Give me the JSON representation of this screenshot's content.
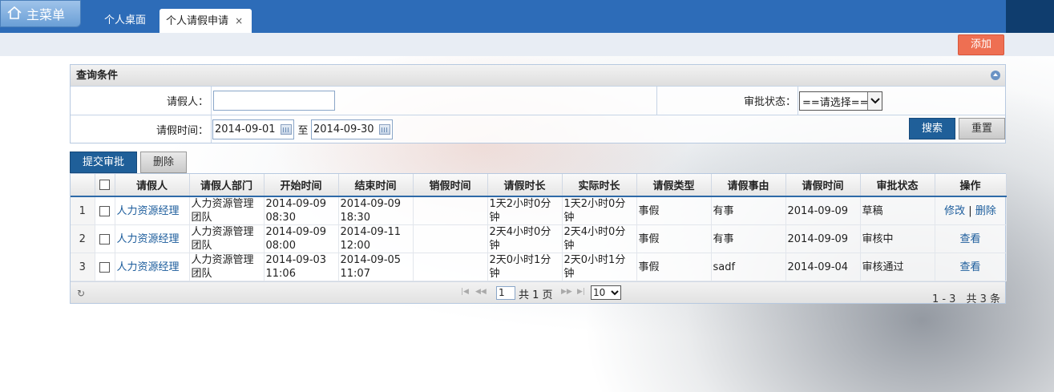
{
  "header": {
    "main_menu": "主菜单",
    "tabs": [
      {
        "label": "个人桌面"
      },
      {
        "label": "个人请假申请",
        "close": "×"
      }
    ]
  },
  "toolbar": {
    "add_label": "添加"
  },
  "query": {
    "title": "查询条件",
    "applicant_label": "请假人：",
    "applicant_value": "",
    "status_label": "审批状态：",
    "status_selected": "==请选择==",
    "time_label": "请假时间：",
    "date_from": "2014-09-01",
    "to_label": "至",
    "date_to": "2014-09-30",
    "search_label": "搜索",
    "reset_label": "重置"
  },
  "actions": {
    "submit_label": "提交审批",
    "delete_label": "删除"
  },
  "table": {
    "columns": [
      "请假人",
      "请假人部门",
      "开始时间",
      "结束时间",
      "销假时间",
      "请假时长",
      "实际时长",
      "请假类型",
      "请假事由",
      "请假时间",
      "审批状态",
      "操作"
    ],
    "rows": [
      {
        "num": "1",
        "applicant": "人力资源经理",
        "dept": "人力资源管理团队",
        "start": "2014-09-09 08:30",
        "end": "2014-09-09 18:30",
        "cancel": "",
        "duration": "1天2小时0分钟",
        "actual": "1天2小时0分钟",
        "type": "事假",
        "reason": "有事",
        "date": "2014-09-09",
        "status": "草稿",
        "op1": "修改",
        "sep": "|",
        "op2": "删除"
      },
      {
        "num": "2",
        "applicant": "人力资源经理",
        "dept": "人力资源管理团队",
        "start": "2014-09-09 08:00",
        "end": "2014-09-11 12:00",
        "cancel": "",
        "duration": "2天4小时0分钟",
        "actual": "2天4小时0分钟",
        "type": "事假",
        "reason": "有事",
        "date": "2014-09-09",
        "status": "审核中",
        "op1": "查看"
      },
      {
        "num": "3",
        "applicant": "人力资源经理",
        "dept": "人力资源管理团队",
        "start": "2014-09-03 11:06",
        "end": "2014-09-05 11:07",
        "cancel": "",
        "duration": "2天0小时1分钟",
        "actual": "2天0小时1分钟",
        "type": "事假",
        "reason": "sadf",
        "date": "2014-09-04",
        "status": "审核通过",
        "op1": "查看"
      }
    ]
  },
  "pager": {
    "page": "1",
    "total_pages_text": "共 1 页",
    "page_size": "10",
    "info": "1 - 3　共 3 条"
  }
}
